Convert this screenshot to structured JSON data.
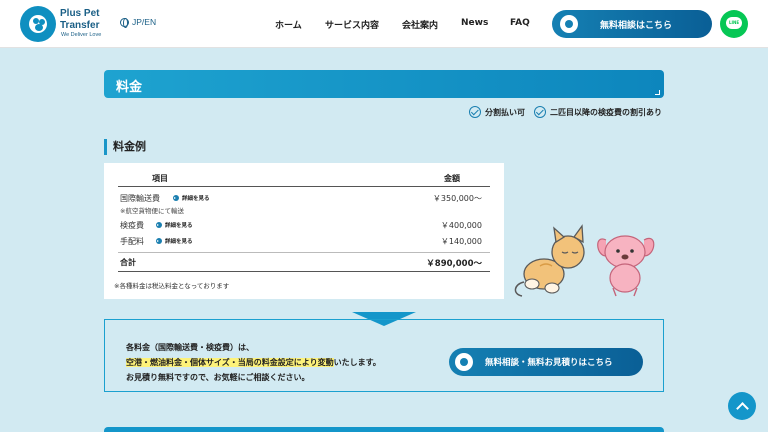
{
  "header": {
    "logo_line1": "Plus Pet",
    "logo_line2": "Transfer",
    "logo_tagline": "We Deliver Love",
    "lang": "JP/EN",
    "nav": [
      "ホーム",
      "サービス内容",
      "会社案内",
      "News",
      "FAQ"
    ],
    "cta_label": "無料相談はこちら",
    "line_label": "LINE"
  },
  "section": {
    "title": "料金",
    "checks": [
      "分割払い可",
      "二匹目以降の検疫費の割引あり"
    ],
    "subtitle": "料金例"
  },
  "price_table": {
    "col_item": "項目",
    "col_amount": "金額",
    "detail_label": "詳細を見る",
    "rows": [
      {
        "label": "国際輸送費",
        "note": "※航空貨物便にて輸送",
        "value": "￥350,000〜"
      },
      {
        "label": "検疫費",
        "value": "￥400,000"
      },
      {
        "label": "手配料",
        "value": "￥140,000"
      }
    ],
    "total_label": "合計",
    "total_value": "￥890,000〜",
    "note": "※各種料金は税込料金となっております"
  },
  "info": {
    "line1": "各料金（国際輸送費・検疫費）は、",
    "line2_highlight": "空港・燃油料金・個体サイズ・当局の料金設定により変動",
    "line2_rest": "いたします。",
    "line3": "お見積り無料ですので、お気軽にご相談ください。",
    "cta_label": "無料相談・無料お見積りはこちら"
  },
  "colors": {
    "accent": "#1496ca",
    "page_bg": "#d2eaf2",
    "highlight": "#fdf27a",
    "line_green": "#06c755"
  }
}
